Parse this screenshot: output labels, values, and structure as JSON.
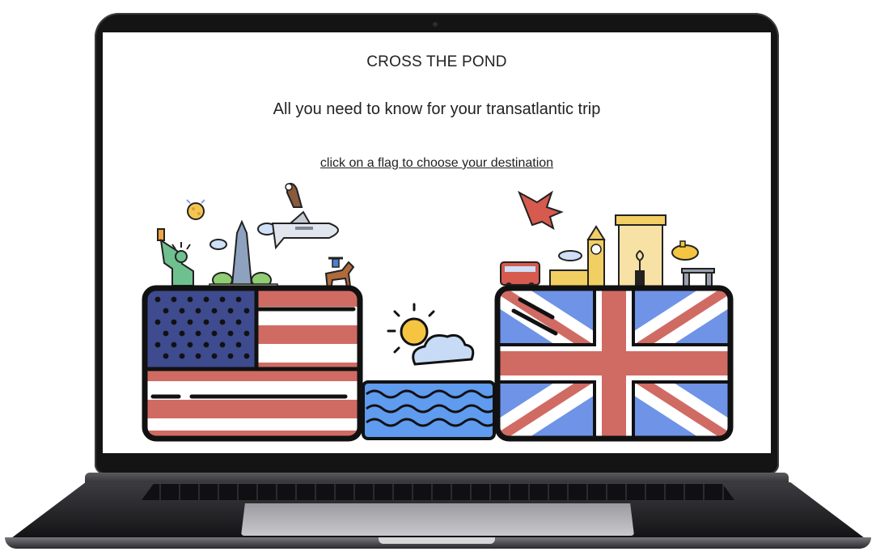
{
  "page": {
    "title": "CROSS THE POND",
    "subtitle": "All you need to know for your transatlantic trip",
    "instruction": "click on a flag to choose your destination"
  },
  "destinations": [
    {
      "name": "usa",
      "icon": "usa-flag-icon"
    },
    {
      "name": "uk",
      "icon": "uk-flag-icon"
    }
  ],
  "colors": {
    "flag_red": "#d06b64",
    "flag_blue_dark": "#3e4b8e",
    "flag_blue_light": "#6f93e6",
    "water": "#5f9bee",
    "outline": "#141414"
  }
}
